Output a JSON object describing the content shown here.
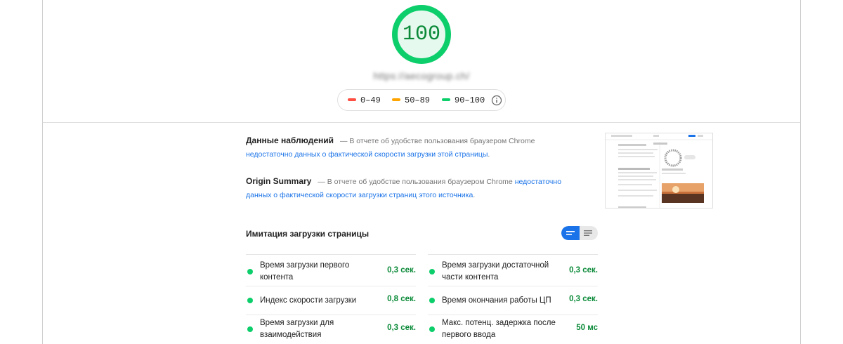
{
  "report": {
    "score": "100",
    "score_fraction": 1.0,
    "url": "https://aecogroup.ch/",
    "colors": {
      "pass": "#0cce6b",
      "average": "#ffa400",
      "fail": "#ff4e42",
      "link": "#1a73e8"
    },
    "legend": [
      {
        "range": "0–49",
        "color": "#ff4e42"
      },
      {
        "range": "50–89",
        "color": "#ffa400"
      },
      {
        "range": "90–100",
        "color": "#0cce6b"
      }
    ],
    "info_icon": "info-icon"
  },
  "field_data": {
    "title": "Данные наблюдений",
    "text": "— В отчете об удобстве пользования браузером Chrome",
    "link": "недостаточно данных о фактической скорости загрузки этой страницы",
    "end": "."
  },
  "origin_summary": {
    "title": "Origin Summary",
    "text": "— В отчете об удобстве пользования браузером Chrome",
    "link": "недостаточно данных о фактической скорости загрузки страниц этого источника",
    "end": "."
  },
  "lab_data": {
    "title": "Имитация загрузки страницы",
    "toggle": {
      "compact_icon": "bars-compact-icon",
      "expanded_icon": "bars-expanded-icon"
    },
    "metrics_left": [
      {
        "label": "Время загрузки первого контента",
        "value": "0,3 сек."
      },
      {
        "label": "Индекс скорости загрузки",
        "value": "0,8 сек."
      },
      {
        "label": "Время загрузки для взаимодействия",
        "value": "0,3 сек."
      }
    ],
    "metrics_right": [
      {
        "label": "Время загрузки достаточной части контента",
        "value": "0,3 сек."
      },
      {
        "label": "Время окончания работы ЦП",
        "value": "0,3 сек."
      },
      {
        "label": "Макс. потенц. задержка после первого ввода",
        "value": "50 мс"
      }
    ]
  },
  "screenshot": {
    "icon": "page-screenshot-thumbnail"
  }
}
